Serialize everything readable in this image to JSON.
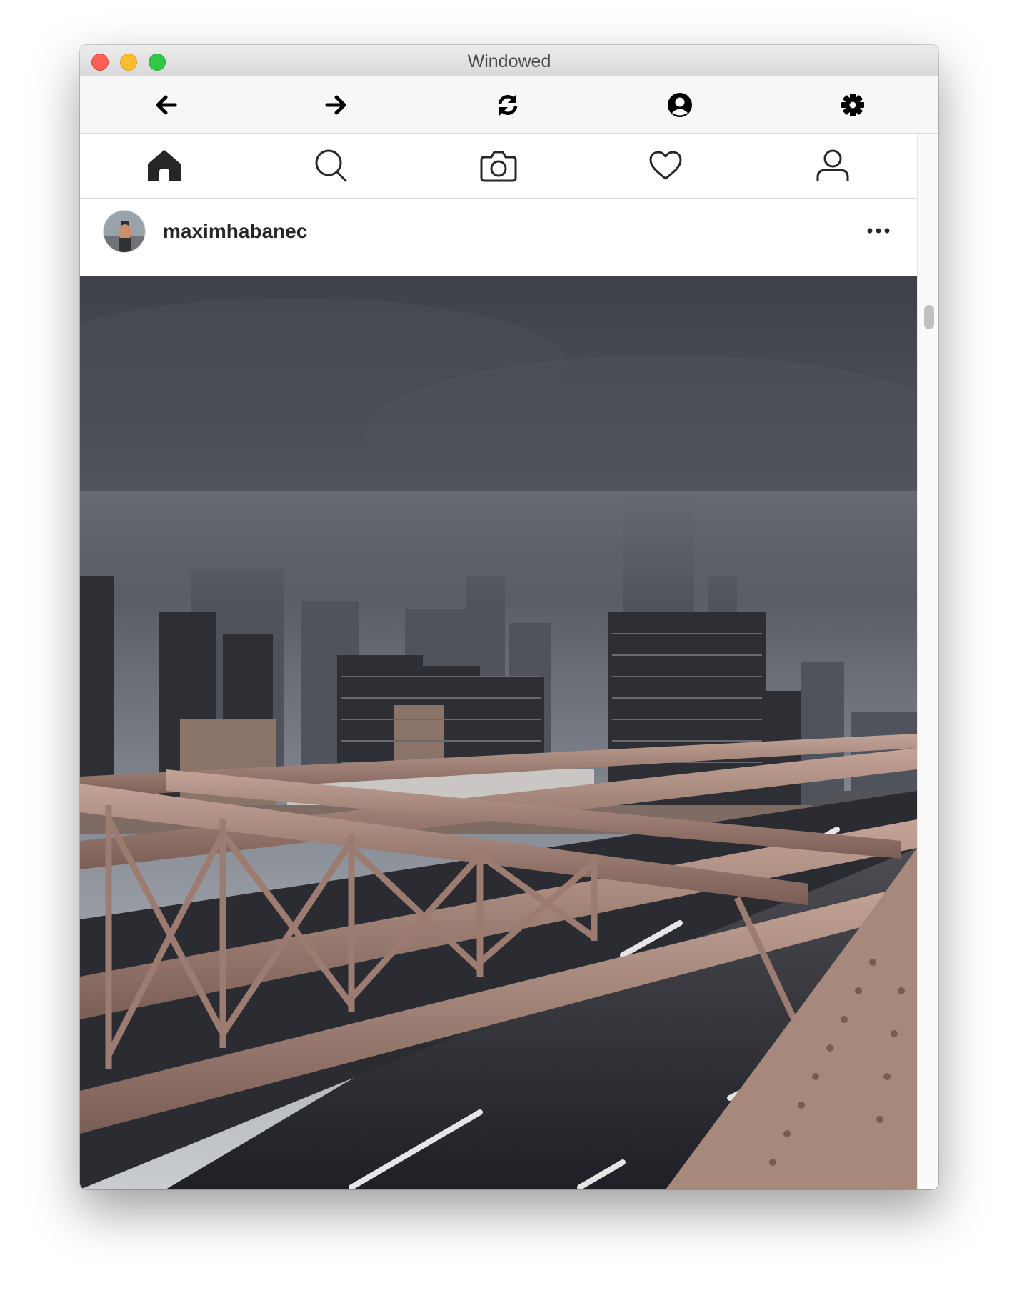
{
  "window": {
    "title": "Windowed"
  },
  "toolbar": {
    "buttons": [
      {
        "icon": "back-arrow-icon"
      },
      {
        "icon": "forward-arrow-icon"
      },
      {
        "icon": "refresh-icon"
      },
      {
        "icon": "account-icon"
      },
      {
        "icon": "gear-icon"
      }
    ]
  },
  "nav": {
    "items": [
      {
        "icon": "home-icon",
        "active": true
      },
      {
        "icon": "search-icon"
      },
      {
        "icon": "camera-icon"
      },
      {
        "icon": "heart-icon"
      },
      {
        "icon": "profile-icon"
      }
    ]
  },
  "post": {
    "username": "maximhabanec",
    "more_icon": "more-dots-icon",
    "image_subject": "city skyline from bridge"
  },
  "colors": {
    "text": "#262626",
    "close": "#fc5f57",
    "minimize": "#fdbc2e",
    "maximize": "#33c748"
  }
}
